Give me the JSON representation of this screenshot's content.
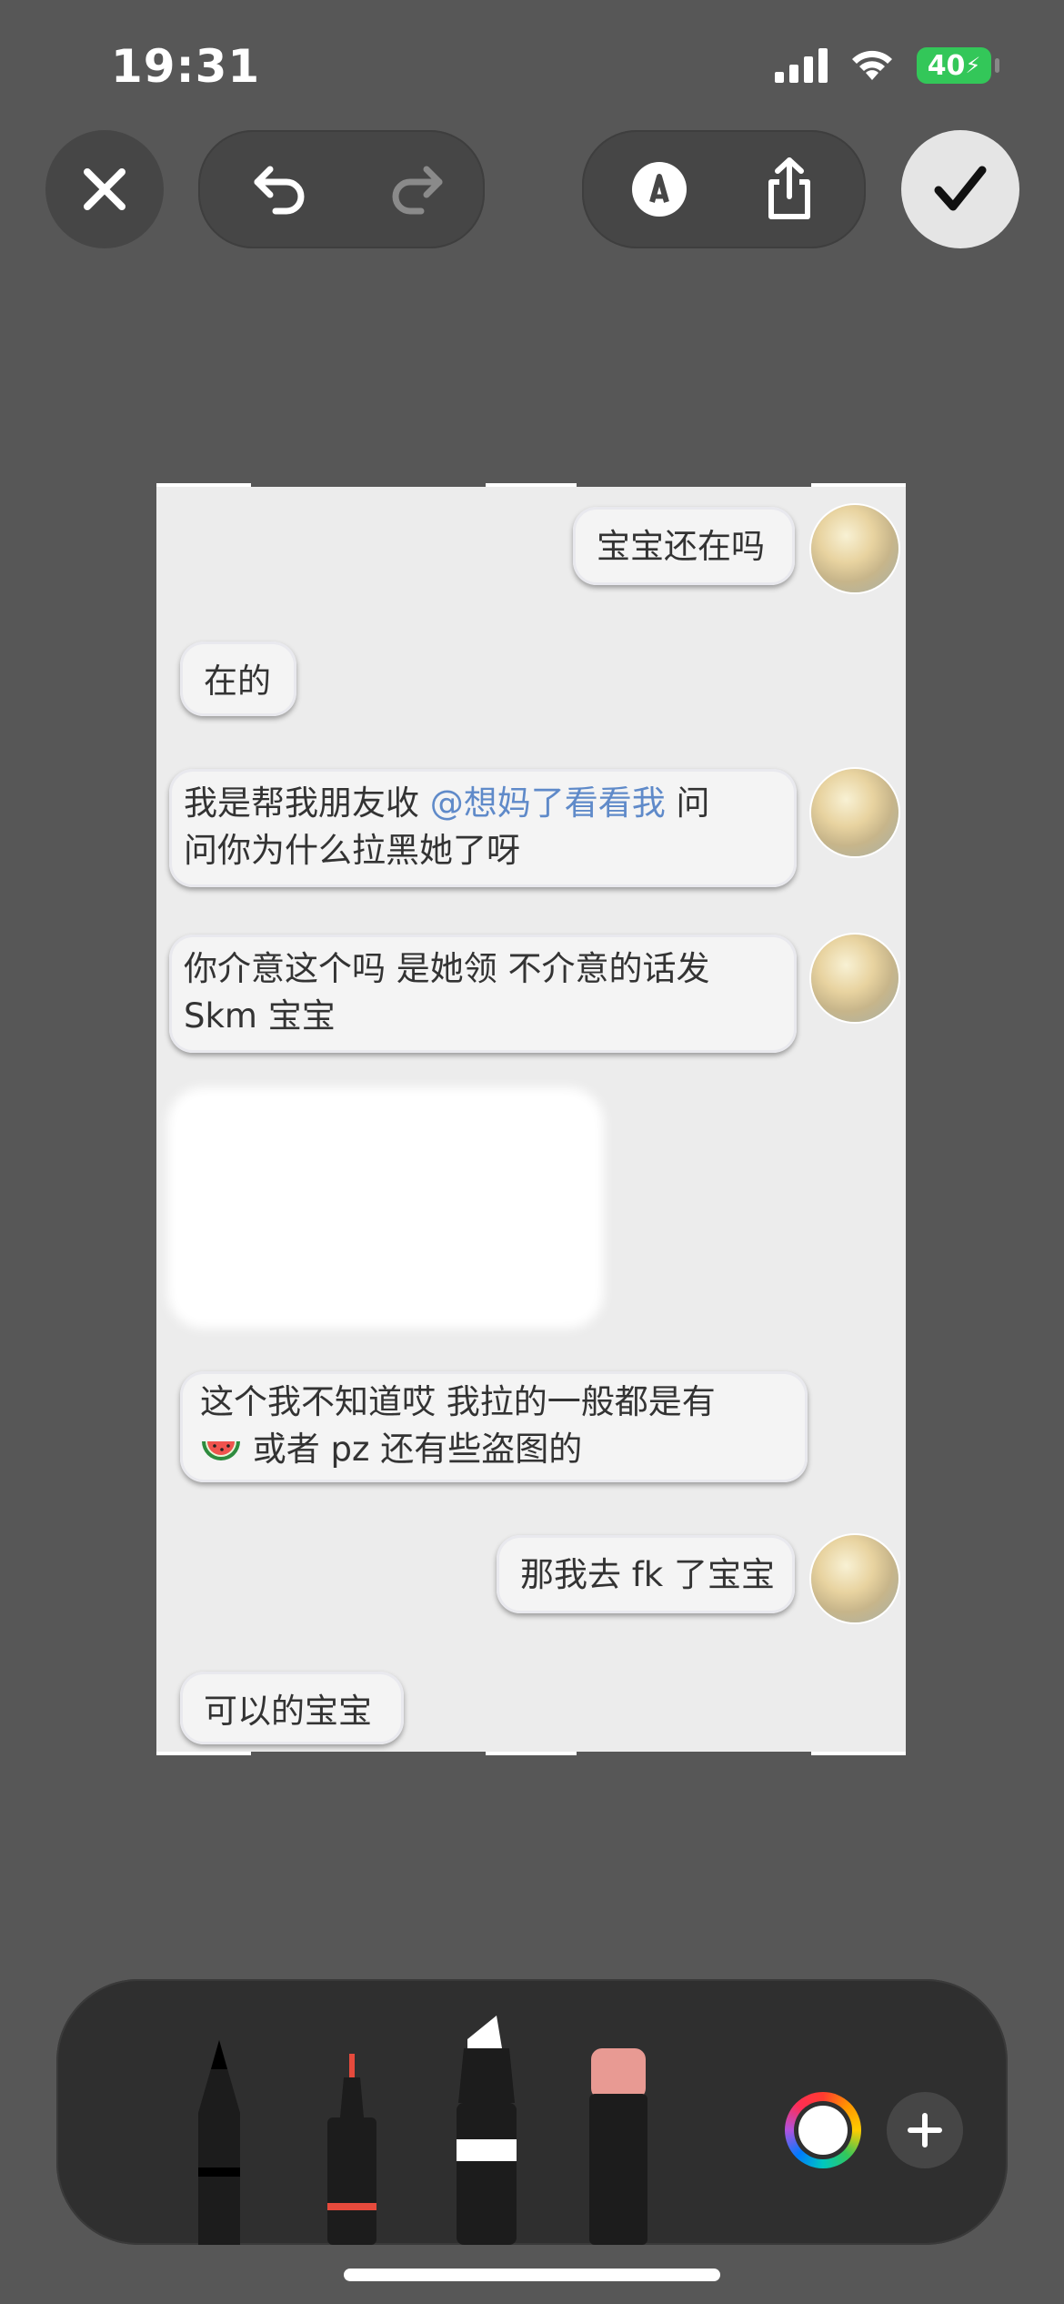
{
  "status_bar": {
    "time": "19:31",
    "battery_level": "40"
  },
  "toolbar_top": {
    "close_icon": "close-icon",
    "undo_icon": "undo-icon",
    "redo_icon": "redo-icon",
    "markup_icon": "markup-pen-icon",
    "share_icon": "share-icon",
    "done_icon": "checkmark-icon"
  },
  "chat": {
    "messages": [
      {
        "side": "right",
        "lines": [
          "宝宝还在吗"
        ]
      },
      {
        "side": "left",
        "lines": [
          "在的"
        ]
      },
      {
        "side": "right",
        "lines": [
          "我是帮我朋友收 ",
          "问你为什么拉黑她了呀"
        ],
        "mention": "@想妈了看看我",
        "after_mention": "  问"
      },
      {
        "side": "right",
        "lines": [
          "你介意这个吗  是她领  不介意的话发",
          "Skm 宝宝"
        ]
      },
      {
        "side": "left",
        "lines": [
          "这个我不知道哎 我拉的一般都是有",
          "或者 pz 还有些盗图的"
        ]
      },
      {
        "side": "right",
        "lines": [
          "那我去 fk 了宝宝"
        ]
      },
      {
        "side": "left",
        "lines": [
          "可以的宝宝"
        ]
      }
    ]
  },
  "tools": [
    {
      "name": "pen",
      "color": "#000000"
    },
    {
      "name": "fine-liner",
      "color": "#e64a3c"
    },
    {
      "name": "marker",
      "color": "#ffffff"
    },
    {
      "name": "eraser",
      "color": "#e89a93"
    }
  ],
  "accent_colors": {
    "done_button": "#e5e5e5",
    "background": "#575757"
  }
}
